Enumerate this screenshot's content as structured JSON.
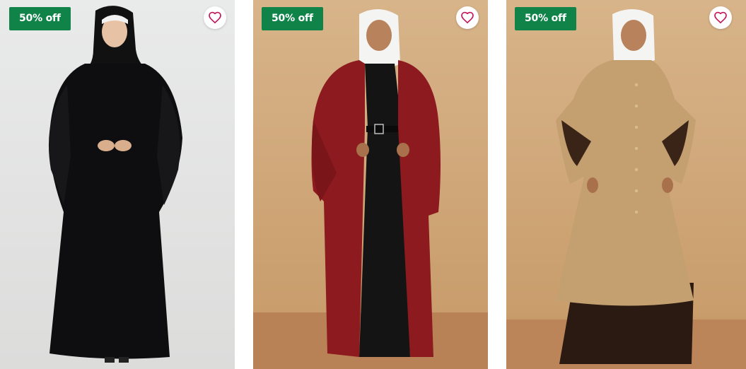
{
  "products": [
    {
      "discount_badge": "50% off",
      "wishlist_icon": "heart-outline-icon",
      "garment_color": "#0d0d0f"
    },
    {
      "discount_badge": "50% off",
      "wishlist_icon": "heart-outline-icon",
      "garment_color": "#8c1a1f"
    },
    {
      "discount_badge": "50% off",
      "wishlist_icon": "heart-outline-icon",
      "garment_color": "#c4a070"
    }
  ],
  "colors": {
    "badge_bg": "#108349",
    "heart_stroke": "#c2185b"
  }
}
